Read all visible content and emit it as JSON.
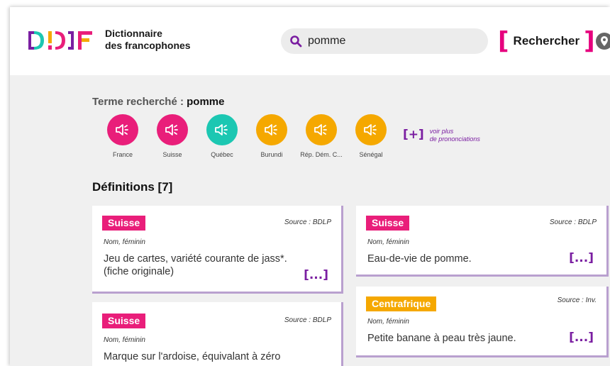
{
  "header": {
    "logo_text": "D!DF",
    "brand_line1": "Dictionnaire",
    "brand_line2": "des francophones",
    "search_value": "pomme",
    "search_button": "Rechercher"
  },
  "term": {
    "label": "Terme recherché :",
    "value": "pomme"
  },
  "pronunciations": [
    {
      "label": "France",
      "color": "#e91e7a"
    },
    {
      "label": "Suisse",
      "color": "#e91e7a"
    },
    {
      "label": "Québec",
      "color": "#1cc7b2"
    },
    {
      "label": "Burundi",
      "color": "#f5a800"
    },
    {
      "label": "Rép. Dém. C...",
      "color": "#f5a800"
    },
    {
      "label": "Sénégal",
      "color": "#f5a800"
    }
  ],
  "more_pron": {
    "symbol": "[+]",
    "line1": "voir plus",
    "line2": "de prononciations"
  },
  "definitions_title": "Définitions [7]",
  "cards": [
    {
      "tag": "Suisse",
      "tag_color": "#e91e7a",
      "source": "Source : BDLP",
      "gram": "Nom, féminin",
      "text1": "Jeu de cartes, variété courante de jass*.",
      "text2": "(fiche originale)",
      "more": "[...]"
    },
    {
      "tag": "Suisse",
      "tag_color": "#e91e7a",
      "source": "Source : BDLP",
      "gram": "Nom, féminin",
      "text1": "Eau-de-vie de pomme.",
      "text2": "",
      "more": "[...]"
    },
    {
      "tag": "Suisse",
      "tag_color": "#e91e7a",
      "source": "Source : BDLP",
      "gram": "Nom, féminin",
      "text1": "Marque sur l'ardoise, équivalant à zéro",
      "text2": "",
      "more": ""
    },
    {
      "tag": "Centrafrique",
      "tag_color": "#f5a800",
      "source": "Source : Inv.",
      "gram": "Nom, féminin",
      "text1": "Petite banane à peau très jaune.",
      "text2": "",
      "more": "[...]"
    }
  ]
}
